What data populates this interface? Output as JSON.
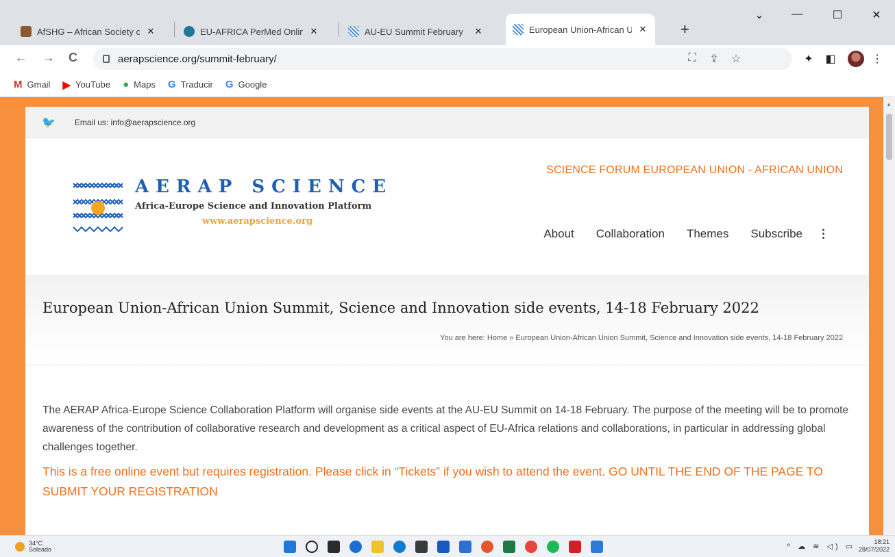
{
  "tabs": [
    {
      "title": "AfSHG – African Society of Human Genetics",
      "favicon_color": "#8b5a2b",
      "active": false
    },
    {
      "title": "EU-AFRICA PerMed Online",
      "favicon_color": "#21759b",
      "active": false
    },
    {
      "title": "AU-EU Summit February",
      "favicon_color": "#4a8fd6",
      "active": false
    },
    {
      "title": "European Union-African Union",
      "favicon_color": "#4a8fd6",
      "active": true
    }
  ],
  "window": {
    "close_glyph": "✕",
    "maximize_glyph": "☐",
    "minimize_glyph": "—",
    "menu_glyph": "⌄",
    "new_tab_glyph": "+"
  },
  "nav": {
    "back": "←",
    "forward": "→",
    "reload": "C"
  },
  "address": {
    "url": "aerapscience.org/summit-february/"
  },
  "toolbar_icons": [
    "translate-icon",
    "share-icon",
    "star-icon",
    "extensions-icon",
    "sidepanel-icon",
    "profile-avatar",
    "kebab-menu-icon"
  ],
  "bookmarks": [
    {
      "label": "Gmail",
      "icon": "M",
      "color": "#d93025"
    },
    {
      "label": "YouTube",
      "icon": "▶",
      "color": "#ff0000"
    },
    {
      "label": "Maps",
      "icon": "●",
      "color": "#34a853"
    },
    {
      "label": "Traducir",
      "icon": "G",
      "color": "#4285f4"
    },
    {
      "label": "Google",
      "icon": "G",
      "color": "#4285f4"
    }
  ],
  "site": {
    "topbar_email": "Email us: info@aerapscience.org",
    "forum_title": "SCIENCE FORUM EUROPEAN UNION - AFRICAN UNION",
    "logo": {
      "brand": "AERAP SCIENCE",
      "subtitle": "Africa-Europe Science and Innovation Platform",
      "url": "www.aerapscience.org"
    },
    "menu": [
      "About",
      "Collaboration",
      "Themes",
      "Subscribe"
    ],
    "menu_more": "⋮",
    "page_title": "European Union-African Union Summit, Science and Innovation side events, 14-18 February 2022",
    "breadcrumb": "You are here: Home » European Union-African Union Summit, Science and Innovation side events, 14-18 February 2022",
    "intro": "The AERAP Africa-Europe Science Collaboration Platform will organise side events at the AU-EU Summit on 14-18 February. The purpose of the meeting will be to promote awareness of the contribution of collaborative research and development as a critical aspect of EU-Africa relations and collaborations, in particular in addressing global challenges together.",
    "notice": "This is a free online event but requires registration. Please click in “Tickets” if you wish to attend the event. GO UNTIL THE END OF THE PAGE TO SUBMIT YOUR REGISTRATION",
    "accent_color": "#f06f1b",
    "frame_color": "#f7903c"
  },
  "taskbar": {
    "temperature": "34°C",
    "weather": "Soleado",
    "time": "18:21",
    "date": "28/07/2022",
    "tray": "^ ☁ ≋ ◁) ▭",
    "app_colors": [
      "#1e78d7",
      "#202124",
      "#2b2b2b",
      "#1b6fd1",
      "#f2c12e",
      "#0f7bd1",
      "#3b3b3b",
      "#185abd",
      "#2f6fce",
      "#e4572e",
      "#1d7a45",
      "#e8453c",
      "#1db954",
      "#d31f26",
      "#2f7ad6"
    ]
  }
}
